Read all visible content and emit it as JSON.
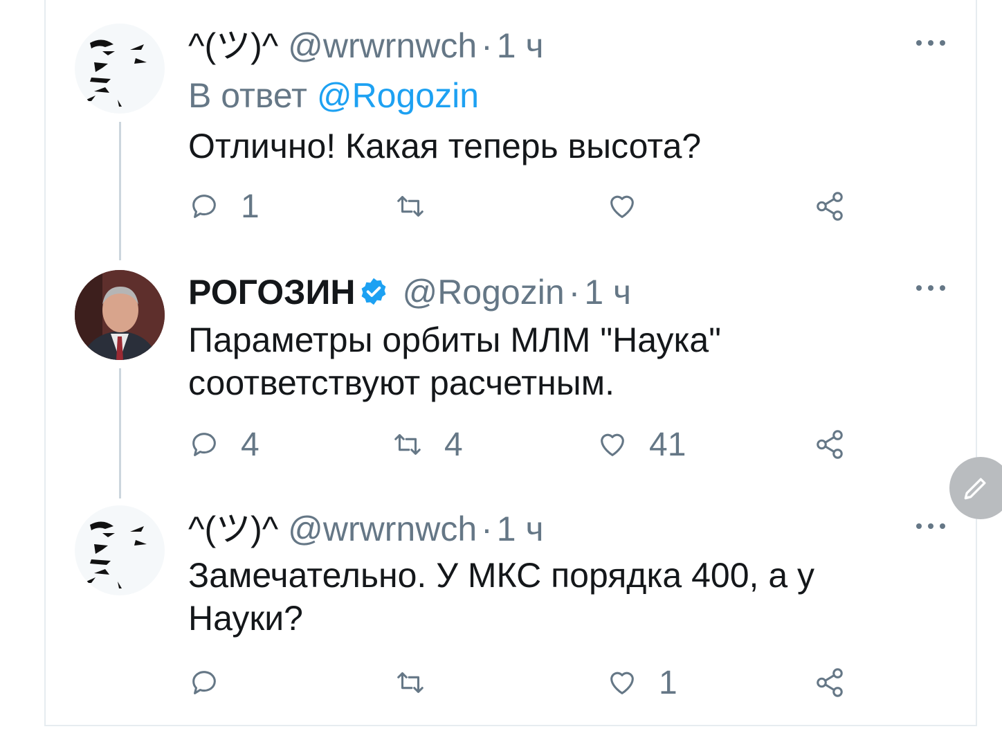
{
  "tweets": [
    {
      "name": "^(ツ)^",
      "handle": "@wrwrnwch",
      "time": "1 ч",
      "replying_prefix": "В ответ",
      "replying_to": "@Rogozin",
      "text": "Отлично! Какая теперь высота?",
      "replies": "1",
      "retweets": "",
      "likes": ""
    },
    {
      "name": "РОГОЗИН",
      "handle": "@Rogozin",
      "time": "1 ч",
      "verified": true,
      "text": "Параметры орбиты МЛМ \"Наука\" соответствуют расчетным.",
      "replies": "4",
      "retweets": "4",
      "likes": "41"
    },
    {
      "name": "^(ツ)^",
      "handle": "@wrwrnwch",
      "time": "1 ч",
      "text": "Замечательно. У МКС порядка 400, а у Науки?",
      "replies": "",
      "retweets": "",
      "likes": "1"
    }
  ],
  "separator": "·",
  "colors": {
    "accent": "#1da1f2",
    "muted": "#657786",
    "line": "#ccd6dd"
  },
  "icons": [
    "reply-icon",
    "retweet-icon",
    "like-icon",
    "share-icon",
    "more-icon",
    "verified-icon",
    "compose-icon"
  ]
}
